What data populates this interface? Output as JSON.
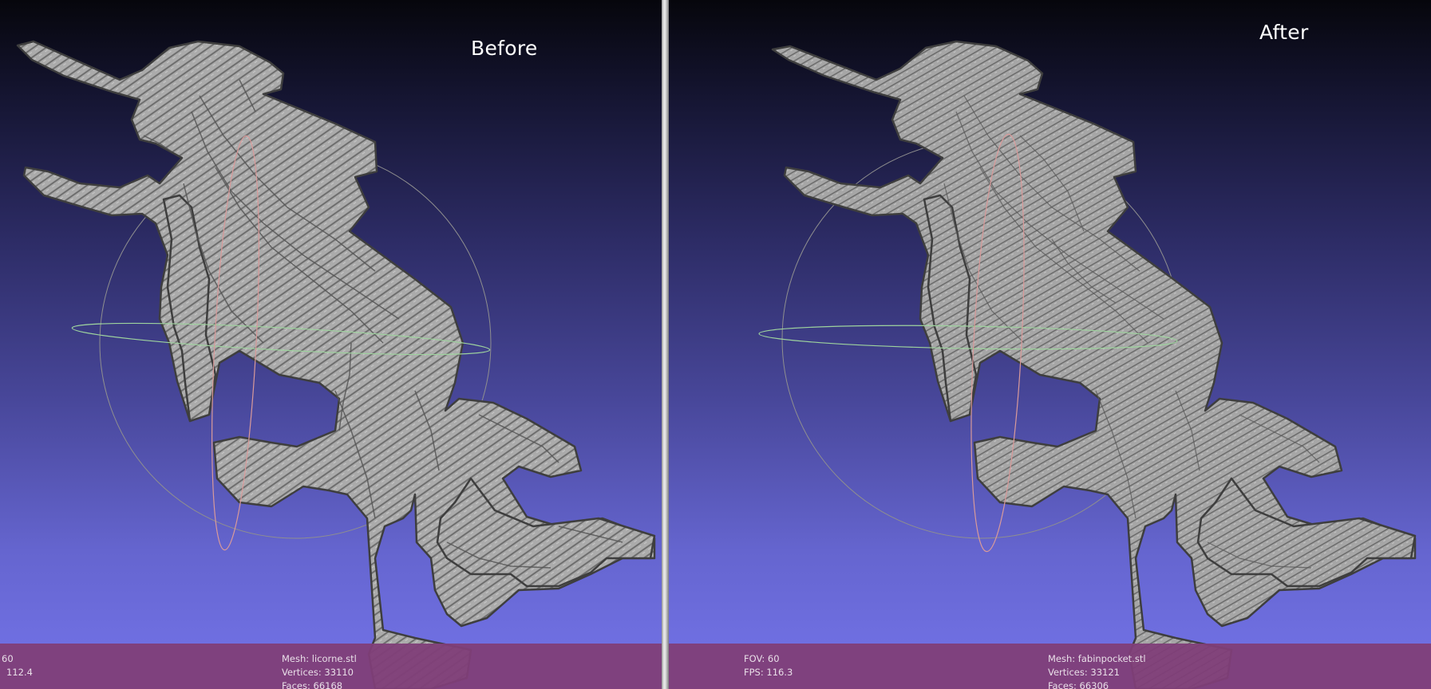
{
  "left_view": {
    "label": "Before",
    "info": {
      "fov": "60",
      "fps": "112.4",
      "mesh": "Mesh: licorne.stl",
      "vertices": "Vertices: 33110",
      "faces": "Faces: 66168"
    }
  },
  "right_view": {
    "label": "After",
    "info": {
      "fov": "FOV: 60",
      "fps": "FPS:   116.3",
      "mesh": "Mesh: fabinpocket.stl",
      "vertices": "Vertices: 33121",
      "faces": "Faces: 66306"
    }
  },
  "colors": {
    "mesh": "#a9a9a9",
    "info_bar": "#803e78",
    "trackball_horizontal": "#9ed39e",
    "trackball_vertical": "#d99a9a",
    "trackball_sphere": "#8f8f8f"
  },
  "icons": [
    "trackball-gizmo",
    "unicorn-mesh"
  ]
}
